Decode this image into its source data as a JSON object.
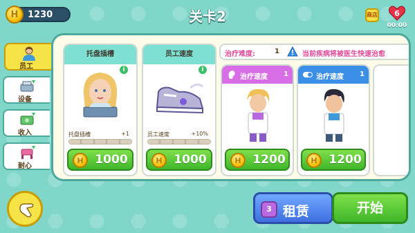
{
  "header": {
    "coins": "1230",
    "coin_symbol": "H",
    "title": "关卡2",
    "small_button": "商店",
    "lives": "6",
    "timer": "00:00"
  },
  "tabs": [
    {
      "label": "员工",
      "icon": "staff-icon",
      "active": true
    },
    {
      "label": "设备",
      "icon": "equipment-icon",
      "active": false
    },
    {
      "label": "收入",
      "icon": "income-icon",
      "active": false
    },
    {
      "label": "耐心",
      "icon": "patience-icon",
      "active": false
    }
  ],
  "staff_cards": [
    {
      "title": "托盘插槽",
      "stat_name": "托盘插槽",
      "stat_value": "+1",
      "price": "1000",
      "info": "i"
    },
    {
      "title": "员工速度",
      "stat_name": "员工速度",
      "stat_value": "+10%",
      "price": "1000",
      "info": "i"
    }
  ],
  "difficulty": {
    "label": "治疗难度:",
    "value": "1",
    "note": "当前疾病将被医生快速治愈"
  },
  "doctors": [
    {
      "label": "治疗速度",
      "level": "1",
      "price": "1200",
      "color": "#d76ee6"
    },
    {
      "label": "治疗速度",
      "level": "1",
      "price": "1200",
      "color": "#3b8fe6"
    }
  ],
  "actions": {
    "rent_badge": "3",
    "rent_label": "租赁",
    "start_label": "开始"
  },
  "colors": {
    "background": "#7fd6c9",
    "panel": "#fffbe9",
    "accent_green": "#3fb62a",
    "accent_blue": "#3f6fe0",
    "header_teal": "#7ee0d2"
  }
}
